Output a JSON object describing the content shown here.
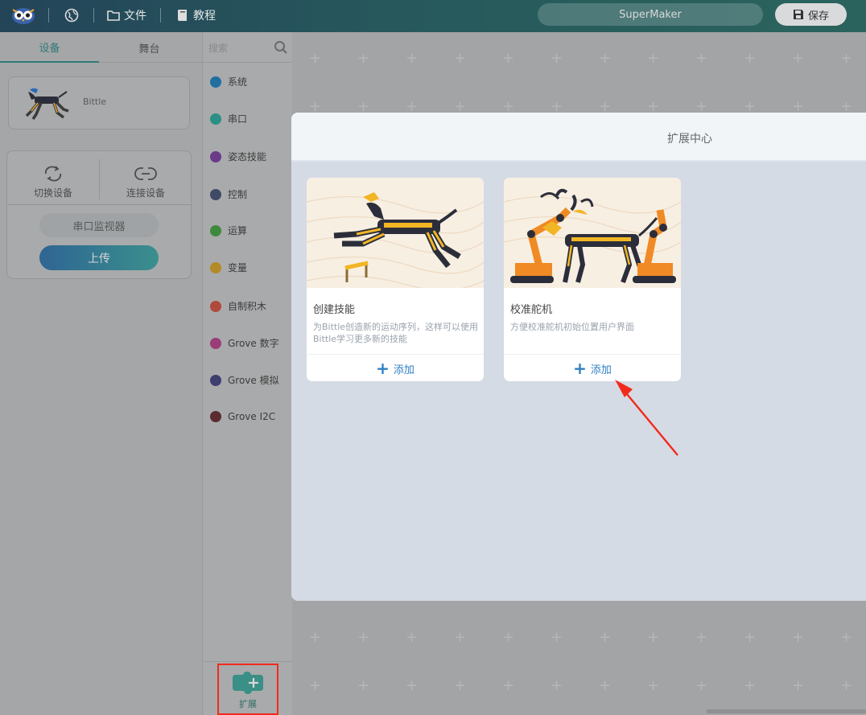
{
  "topbar": {
    "file_label": "文件",
    "tutorial_label": "教程",
    "project_name": "SuperMaker",
    "save_label": "保存"
  },
  "left_panel": {
    "tabs": [
      "设备",
      "舞台"
    ],
    "device_name": "Bittle",
    "switch_device": "切换设备",
    "connect_device": "连接设备",
    "serial_monitor": "串口监视器",
    "upload": "上传"
  },
  "categories": {
    "search_placeholder": "搜索",
    "items": [
      {
        "label": "系统",
        "color": "#1f6fa0"
      },
      {
        "label": "串口",
        "color": "#2b8f86"
      },
      {
        "label": "姿态技能",
        "color": "#6a3b88"
      },
      {
        "label": "控制",
        "color": "#3f4a66"
      },
      {
        "label": "运算",
        "color": "#3e8a3c"
      },
      {
        "label": "变量",
        "color": "#b48a26"
      },
      {
        "label": "自制积木",
        "color": "#b04a3c"
      },
      {
        "label": "Grove 数字",
        "color": "#9a3c78"
      },
      {
        "label": "Grove 模拟",
        "color": "#3e3f6e"
      },
      {
        "label": "Grove I2C",
        "color": "#5a2c30"
      }
    ],
    "extension_label": "扩展"
  },
  "modal": {
    "title": "扩展中心",
    "cards": [
      {
        "title": "创建技能",
        "description": "为Bittle创造新的运动序列，这样可以使用Bittle学习更多新的技能",
        "add_label": "添加"
      },
      {
        "title": "校准舵机",
        "description": "方便校准舵机初始位置用户界面",
        "add_label": "添加"
      }
    ]
  },
  "colors": {
    "accent": "#2d7fc3",
    "highlight_box": "#f22a1c",
    "robot_yellow": "#f2b625",
    "robot_dark": "#2b2e3a",
    "robot_orange": "#f08a24"
  }
}
